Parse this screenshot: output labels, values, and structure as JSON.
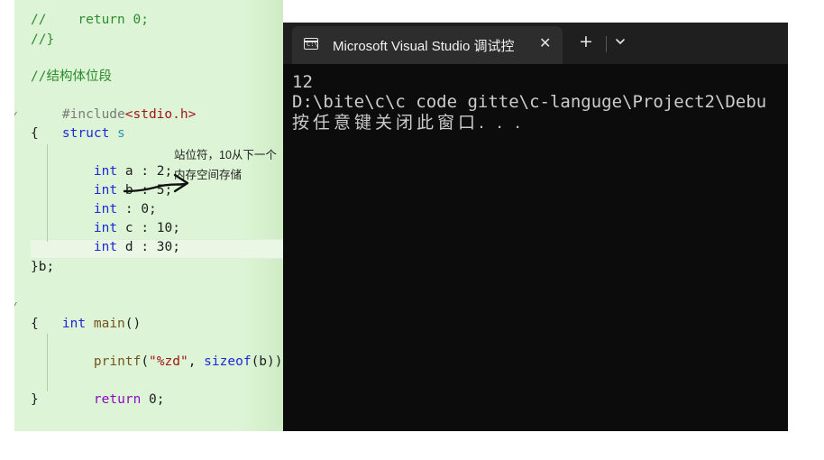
{
  "editor": {
    "lines": {
      "l0": "//    return 0;",
      "l1": "//}",
      "l2": "//结构体位段",
      "l3_pre": "#include",
      "l3_inc": "<stdio.h>",
      "l4_kw": "struct",
      "l4_name": "s",
      "l5": "{",
      "l6_ty": "int",
      "l6_rest": " a : 2;",
      "l7_ty": "int",
      "l7_rest": " b : 5;",
      "l8_ty": "int",
      "l8_rest": " : 0;",
      "l9_ty": "int",
      "l9_rest": " c : 10;",
      "l10_ty": "int",
      "l10_rest": " d : 30;",
      "l11": "}b;",
      "l12_ty": "int",
      "l12_fn": "main",
      "l12_rest": "()",
      "l13": "{",
      "l14_fn": "printf",
      "l14_open": "(",
      "l14_str": "\"%zd\"",
      "l14_mid": ", ",
      "l14_kw": "sizeof",
      "l14_end": "(b));",
      "l15_kw": "return",
      "l15_rest": " 0;",
      "l16": "}"
    },
    "annotation": {
      "line1": "站位符，10从下一个",
      "line2": "内存空间存储"
    }
  },
  "console": {
    "tab_title": "Microsoft Visual Studio 调试控",
    "tab_icon_glyph": "C:\\",
    "tab_close": "✕",
    "new_tab": "+",
    "output": {
      "line1": "12",
      "line2": "D:\\bite\\c\\c code gitte\\c-languge\\Project2\\Debu",
      "line3": "按任意键关闭此窗口. . ."
    },
    "colors": {
      "background": "#0c0c0c",
      "titlebar": "#1f1f1f",
      "tab": "#2d2d2d",
      "text": "#cccccc"
    }
  },
  "icons": [
    "terminal-icon",
    "close-icon",
    "plus-icon",
    "chevron-down-icon",
    "hand-drawn-arrow"
  ]
}
